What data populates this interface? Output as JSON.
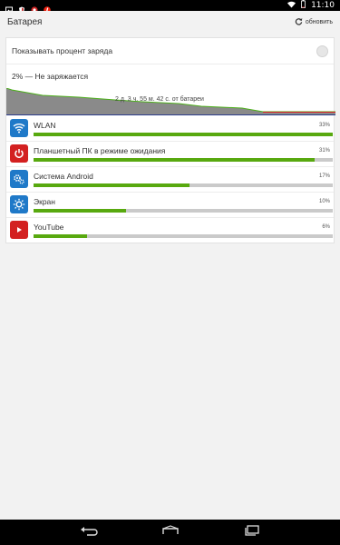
{
  "status_bar": {
    "time": "11:10",
    "icons": [
      "image-icon",
      "shield-icon",
      "red-badge-icon",
      "red-app-icon",
      "wifi-icon",
      "battery-icon"
    ]
  },
  "action_bar": {
    "title": "Батарея",
    "refresh_label": "обновить"
  },
  "settings": {
    "show_percent_label": "Показывать процент заряда",
    "show_percent_checked": false
  },
  "battery": {
    "status": "2% — Не заряжается",
    "time_on_battery": "2 д. 3 ч. 55 м. 42 с. от батареи",
    "level_percent": 2
  },
  "usage": [
    {
      "name": "WLAN",
      "percent_text": "33%",
      "fraction": 1.0,
      "icon": "wifi-icon",
      "icon_color": "#1f79c8"
    },
    {
      "name": "Планшетный ПК в режиме ожидания",
      "percent_text": "31%",
      "fraction": 0.94,
      "icon": "power-icon",
      "icon_color": "#d32020"
    },
    {
      "name": "Система Android",
      "percent_text": "17%",
      "fraction": 0.52,
      "icon": "gears-icon",
      "icon_color": "#1f79c8"
    },
    {
      "name": "Экран",
      "percent_text": "10%",
      "fraction": 0.31,
      "icon": "brightness-icon",
      "icon_color": "#1f79c8"
    },
    {
      "name": "YouTube",
      "percent_text": "6%",
      "fraction": 0.18,
      "icon": "youtube-icon",
      "icon_color": "#d32020"
    }
  ],
  "nav": [
    "back-icon",
    "home-icon",
    "recents-icon"
  ]
}
